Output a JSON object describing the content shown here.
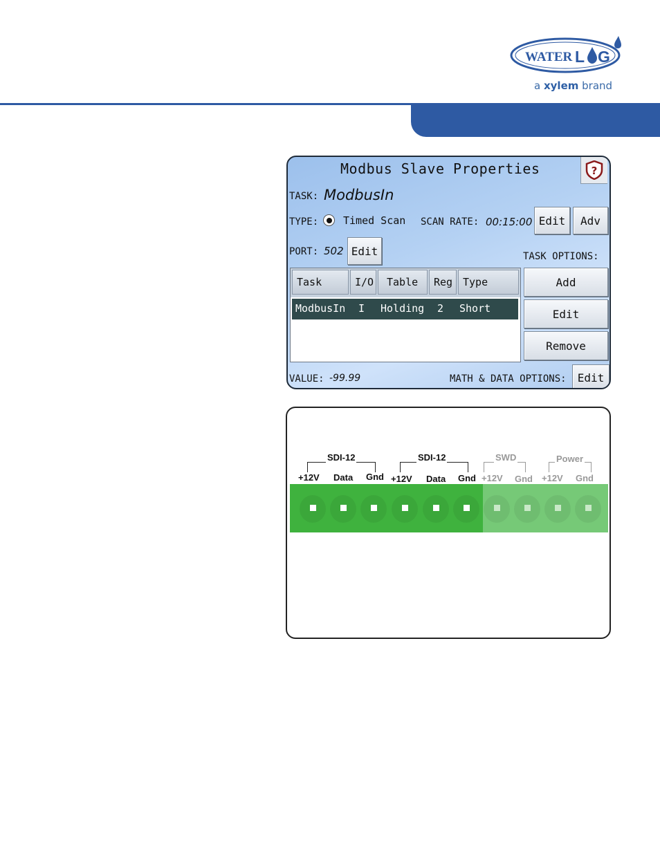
{
  "header": {
    "logo_text": "WATERLOG",
    "brand_prefix": "a ",
    "brand_name": "xylem",
    "brand_suffix": " brand"
  },
  "screen": {
    "title": "Modbus Slave Properties",
    "help_icon": "question-shield-icon",
    "task_label": "TASK:",
    "task_value": "ModbusIn",
    "type_label": "TYPE:",
    "type_value": "Timed Scan",
    "scan_rate_label": "SCAN RATE:",
    "scan_rate_value": "00:15:00",
    "edit_label": "Edit",
    "adv_label": "Adv",
    "port_label": "PORT:",
    "port_value": "502",
    "task_options_label": "TASK OPTIONS:",
    "add_label": "Add",
    "remove_label": "Remove",
    "columns": [
      "Task",
      "I/O",
      "Table",
      "Reg",
      "Type"
    ],
    "rows": [
      {
        "task": "ModbusIn",
        "io": "I",
        "table": "Holding",
        "reg": "2",
        "type": "Short"
      }
    ],
    "value_label": "VALUE:",
    "value": "-99.99",
    "math_label": "MATH & DATA OPTIONS:"
  },
  "connector": {
    "groups": [
      "SDI-12",
      "SDI-12",
      "SWD",
      "Power"
    ],
    "pins": [
      "+12V",
      "Data",
      "Gnd",
      "+12V",
      "Data",
      "Gnd",
      "+12V",
      "Gnd",
      "+12V",
      "Gnd"
    ],
    "colors": {
      "active": "#3fb23e",
      "inactive": "#76c977"
    }
  },
  "colors": {
    "accent": "#2e5aa3"
  }
}
